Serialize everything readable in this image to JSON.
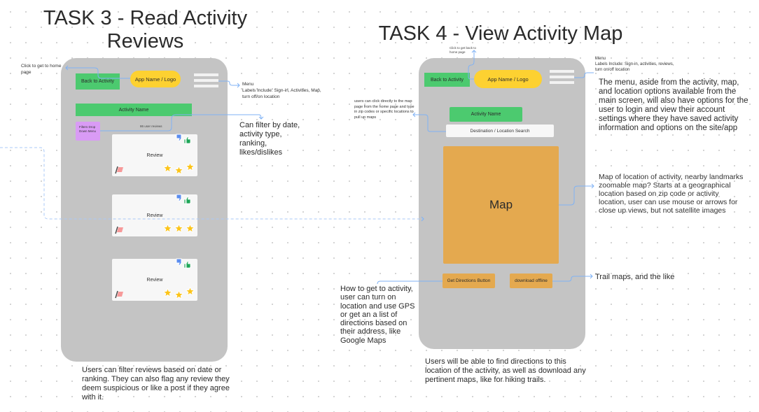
{
  "task3": {
    "title_line1": "TASK 3 - Read Activity",
    "title_line2": "Reviews",
    "annotation_home": "Click to get to home page",
    "back_button": "Back to Activity",
    "logo": "App Name / Logo",
    "menu_note_title": "Menu",
    "menu_note_body": "Labels Include: Sign-in, Activities, Map, turn off/on location",
    "activity_name": "Activity Name",
    "filters_menu": "Filters Drop Down Menu",
    "review_count": "86 user reviews",
    "filter_note": "Can filter by date, activity type, ranking, likes/dislikes",
    "reviews": [
      {
        "label": "Review",
        "rating": 3
      },
      {
        "label": "Review",
        "rating": 3
      },
      {
        "label": "Review",
        "rating": 3
      }
    ],
    "icons": {
      "dislike": "thumbs-down-icon",
      "like": "thumbs-up-icon",
      "flag": "flag-icon",
      "star": "star-icon"
    },
    "caption": "Users can filter reviews based on date or ranking. They can also flag any review they deem suspicious or like a post if they agree with it."
  },
  "task4": {
    "title": "TASK 4 - View Activity Map",
    "annotation_back": "Click to get back to home page",
    "back_button": "Back to Activity",
    "logo": "App Name / Logo",
    "menu_note_title": "Menu",
    "menu_note_body": "Labels Include:  Sign-in, activities, reviews, turn on/off location",
    "menu_description": "The menu, aside from the activity, map, and location options available from the main screen, will also have options for the user to login and view their account settings where they have saved activity information and options on the site/app",
    "search_note": "users can click directly to the map page from the home page and type in zip codes or specific locations to pull up maps",
    "activity_name": "Activity Name",
    "search_placeholder": "Destination / Location Search",
    "map_label": "Map",
    "map_note": "Map of location of activity, nearby landmarks\nzoomable map? Starts at a geographical location based on zip code or activity location, user can use mouse or arrows for close up views, but not satellite images",
    "directions_button": "Get Directions Button",
    "download_button": "download offline",
    "trail_note": "Trail maps, and the like",
    "directions_note": "How to get to activity, user can turn on location and use GPS or get an a list of directions based on their address, like Google Maps",
    "caption": "Users will be able to find directions to this location of the activity, as well as download any pertinent maps, like for hiking trails."
  },
  "colors": {
    "phone": "#c4c4c4",
    "green": "#4cca6f",
    "yellow": "#fdd131",
    "purple": "#d99bf5",
    "orange": "#e4a94f",
    "connector": "#7fb2f5",
    "like": "#1ea557",
    "dislike": "#5b8def",
    "flag": "#f79a9a",
    "star": "#fcc419"
  }
}
